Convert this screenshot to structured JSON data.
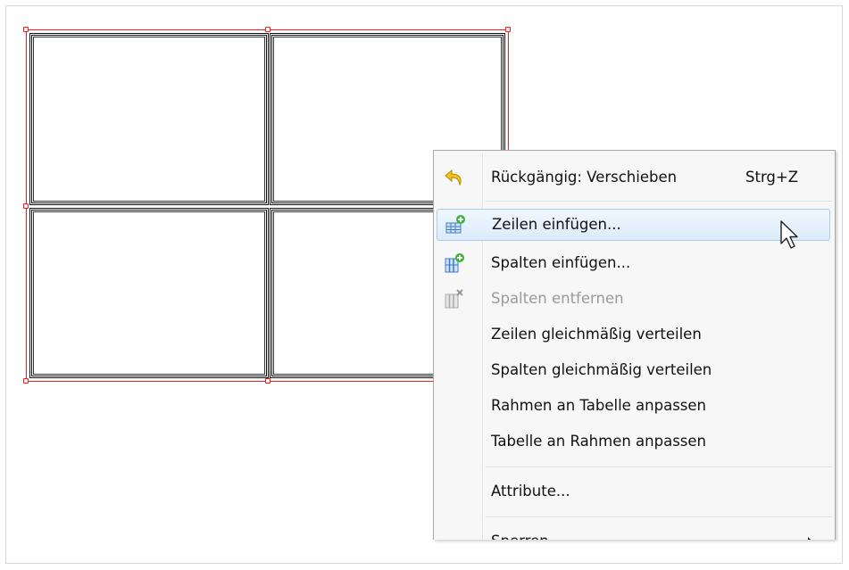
{
  "menu": {
    "items": [
      {
        "label": "Rückgängig: Verschieben",
        "shortcut": "Strg+Z",
        "icon": "undo-icon",
        "enabled": true
      },
      {
        "label": "Zeilen einfügen...",
        "icon": "insert-rows-icon",
        "enabled": true,
        "hovered": true
      },
      {
        "label": "Spalten einfügen...",
        "icon": "insert-columns-icon",
        "enabled": true
      },
      {
        "label": "Spalten entfernen",
        "icon": "delete-columns-icon",
        "enabled": false
      },
      {
        "label": "Zeilen gleichmäßig verteilen",
        "enabled": true
      },
      {
        "label": "Spalten gleichmäßig verteilen",
        "enabled": true
      },
      {
        "label": "Rahmen an Tabelle anpassen",
        "enabled": true
      },
      {
        "label": "Tabelle an Rahmen anpassen",
        "enabled": true
      },
      {
        "label": "Attribute...",
        "enabled": true
      },
      {
        "label": "Sperren",
        "enabled": true,
        "has_submenu": true
      }
    ]
  },
  "colors": {
    "selection": "#ff1a1a",
    "hover_background": "#dcebfb",
    "hover_border": "#a8cdf1",
    "menu_background": "#f7f7f7",
    "disabled_text": "#9a9a9a"
  }
}
